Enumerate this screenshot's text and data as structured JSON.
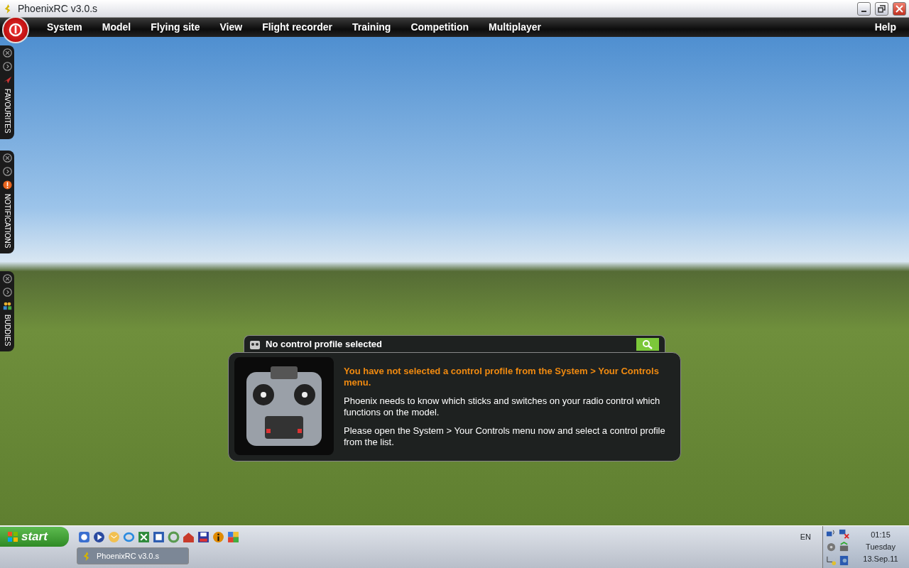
{
  "window": {
    "title": "PhoenixRC v3.0.s"
  },
  "menu": {
    "items": [
      "System",
      "Model",
      "Flying site",
      "View",
      "Flight recorder",
      "Training",
      "Competition",
      "Multiplayer"
    ],
    "help": "Help"
  },
  "side_panels": [
    {
      "label": "FAVOURITES",
      "kind": "favourites"
    },
    {
      "label": "NOTIFICATIONS",
      "kind": "notifications"
    },
    {
      "label": "BUDDIES",
      "kind": "buddies"
    }
  ],
  "dialog": {
    "title": "No control profile selected",
    "heading": "You have not selected a control profile from the System > Your Controls menu.",
    "paragraphs": [
      "Phoenix needs to know which sticks and switches on your radio control which functions on the model.",
      "Please open the System > Your Controls menu now and select a control profile from the list."
    ]
  },
  "taskbar": {
    "start": "start",
    "task": "PhoenixRC v3.0.s",
    "language": "EN",
    "time": "01:15",
    "day": "Tuesday",
    "date": "13.Sep.11"
  }
}
